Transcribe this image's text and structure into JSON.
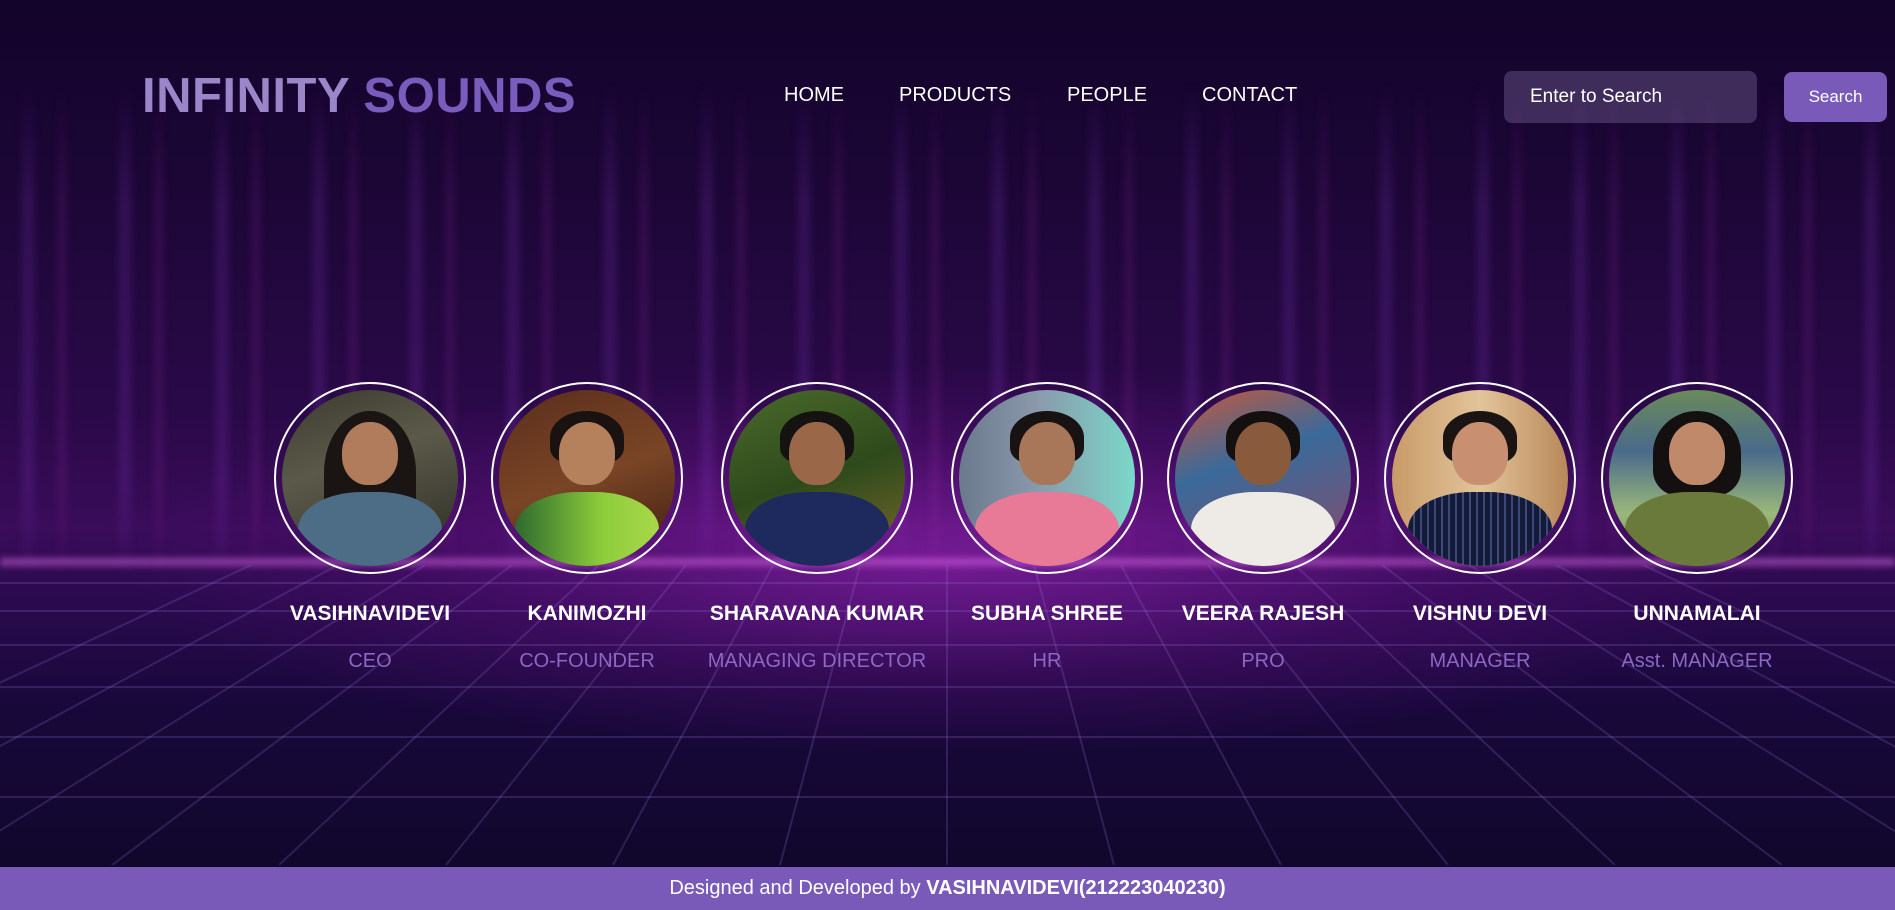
{
  "brand": {
    "part1": "INFINITY",
    "part2": "SOUNDS"
  },
  "nav": {
    "items": [
      "HOME",
      "PRODUCTS",
      "PEOPLE",
      "CONTACT"
    ]
  },
  "search": {
    "placeholder": "Enter to Search",
    "button_label": "Search"
  },
  "people": [
    {
      "name": "VASIHNAVIDEVI",
      "role": "CEO"
    },
    {
      "name": "KANIMOZHI",
      "role": "CO-FOUNDER"
    },
    {
      "name": "SHARAVANA KUMAR",
      "role": "MANAGING DIRECTOR"
    },
    {
      "name": "SUBHA SHREE",
      "role": "HR"
    },
    {
      "name": "VEERA RAJESH",
      "role": "PRO"
    },
    {
      "name": "VISHNU DEVI",
      "role": "MANAGER"
    },
    {
      "name": "UNNAMALAI",
      "role": "Asst. MANAGER"
    }
  ],
  "footer": {
    "prefix": "Designed and Developed by ",
    "author": "VASIHNAVIDEVI(212223040230)"
  },
  "colors": {
    "accent": "#7a5ab8",
    "logo_light": "#9b86c9",
    "logo_dark": "#7a5cbd",
    "role_text": "#8a68c4"
  }
}
